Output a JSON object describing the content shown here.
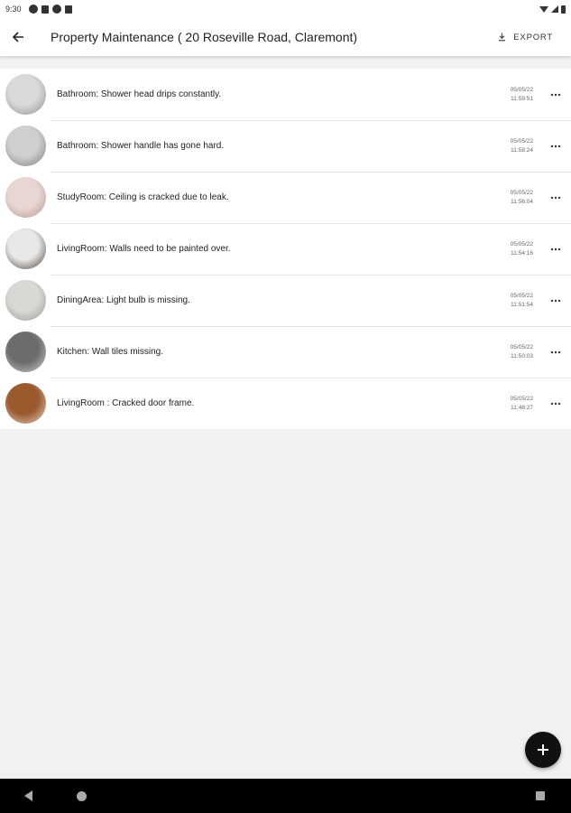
{
  "status_bar": {
    "time": "9:30"
  },
  "app_bar": {
    "title": "Property Maintenance ( 20 Roseville Road, Claremont)",
    "export_label": "EXPORT"
  },
  "items": [
    {
      "description": "Bathroom: Shower head drips constantly.",
      "date": "05/05/22",
      "time": "11:59:51",
      "thumb_colors": [
        "#d9d9d9",
        "#8f8f8f"
      ]
    },
    {
      "description": "Bathroom: Shower handle has gone hard.",
      "date": "05/05/22",
      "time": "11:58:24",
      "thumb_colors": [
        "#cfcfcf",
        "#7e7e7e"
      ]
    },
    {
      "description": "StudyRoom: Ceiling is cracked due to leak.",
      "date": "05/05/22",
      "time": "11:56:04",
      "thumb_colors": [
        "#e7d6d2",
        "#b59a8e"
      ]
    },
    {
      "description": "LivingRoom: Walls need to be painted over.",
      "date": "05/05/22",
      "time": "11:54:16",
      "thumb_colors": [
        "#e8e8e8",
        "#4a3a30"
      ]
    },
    {
      "description": "DiningArea: Light bulb is missing.",
      "date": "05/05/22",
      "time": "11:51:54",
      "thumb_colors": [
        "#d8d8d4",
        "#9a9a92"
      ]
    },
    {
      "description": "Kitchen: Wall tiles missing.",
      "date": "05/05/22",
      "time": "11:50:03",
      "thumb_colors": [
        "#6c6c6c",
        "#cfcfcf"
      ]
    },
    {
      "description": "LivingRoom : Cracked door frame.",
      "date": "05/05/22",
      "time": "11:48:27",
      "thumb_colors": [
        "#9b5a2e",
        "#e4d8cc"
      ]
    }
  ]
}
